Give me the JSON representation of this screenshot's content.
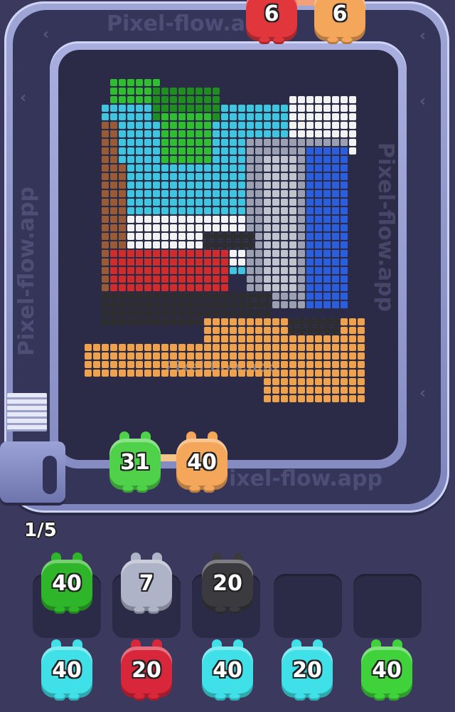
{
  "watermark": "Pixel-flow.app",
  "progress": {
    "label": "1/5"
  },
  "conveyor": [
    {
      "value": "6",
      "color": "#e1373c"
    },
    {
      "value": "6",
      "color": "#f4a65a"
    }
  ],
  "active_shooters": [
    {
      "value": "31",
      "color": "#4fd24a"
    },
    {
      "value": "40",
      "color": "#f4a65a"
    }
  ],
  "queue_row1": [
    {
      "value": "40",
      "color": "#2fb52a"
    },
    {
      "value": "7",
      "color": "#aeb3c7"
    },
    {
      "value": "20",
      "color": "#3a3a3f"
    },
    {
      "value": "",
      "color": ""
    },
    {
      "value": "",
      "color": ""
    }
  ],
  "queue_row2": [
    {
      "value": "40",
      "color": "#3fe0e8"
    },
    {
      "value": "20",
      "color": "#d8263a"
    },
    {
      "value": "40",
      "color": "#3fe0e8"
    },
    {
      "value": "20",
      "color": "#3fe0e8"
    },
    {
      "value": "40",
      "color": "#3fd23a"
    }
  ],
  "colors": {
    "accent": "#9fa6d6",
    "background": "#3b3a5e",
    "board": "#2c2b47"
  }
}
